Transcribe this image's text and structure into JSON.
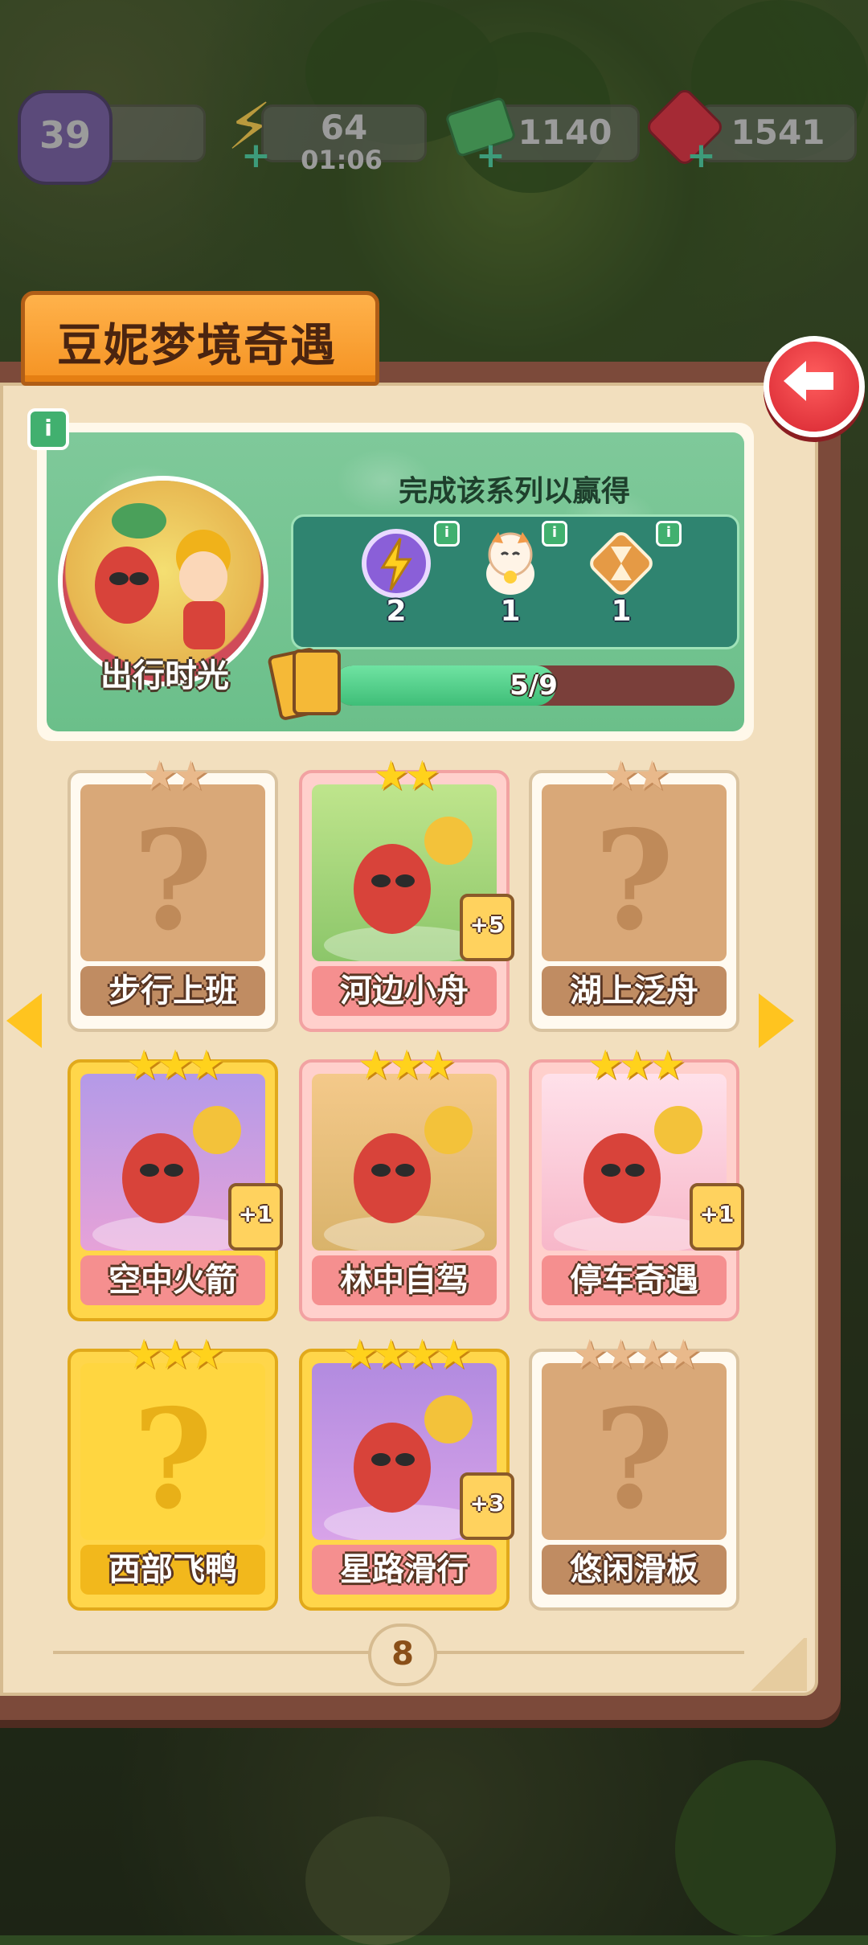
{
  "hud": {
    "level": "39",
    "energy": "64",
    "energy_timer": "01:06",
    "cash": "1140",
    "gems": "1541"
  },
  "title": "豆妮梦境奇遇",
  "series": {
    "name": "出行时光",
    "reward_title": "完成该系列以赢得",
    "rewards": [
      {
        "icon": "lightning-orb-icon",
        "count": "2"
      },
      {
        "icon": "lucky-cat-icon",
        "count": "1"
      },
      {
        "icon": "hourglass-icon",
        "count": "1"
      }
    ],
    "progress_text": "5/9",
    "progress_fraction": 0.556
  },
  "cards": [
    {
      "name": "步行上班",
      "stars": 2,
      "max_stars": 2,
      "state": "locked",
      "frame": "white",
      "dup": ""
    },
    {
      "name": "河边小舟",
      "stars": 2,
      "max_stars": 2,
      "state": "owned",
      "frame": "pink",
      "dup": "+5"
    },
    {
      "name": "湖上泛舟",
      "stars": 2,
      "max_stars": 2,
      "state": "locked",
      "frame": "white",
      "dup": ""
    },
    {
      "name": "空中火箭",
      "stars": 3,
      "max_stars": 3,
      "state": "owned",
      "frame": "gold",
      "dup": "+1"
    },
    {
      "name": "林中自驾",
      "stars": 3,
      "max_stars": 3,
      "state": "owned",
      "frame": "pink",
      "dup": ""
    },
    {
      "name": "停车奇遇",
      "stars": 3,
      "max_stars": 3,
      "state": "owned",
      "frame": "pink",
      "dup": "+1"
    },
    {
      "name": "西部飞鸭",
      "stars": 3,
      "max_stars": 3,
      "state": "locked",
      "frame": "gold",
      "dup": ""
    },
    {
      "name": "星路滑行",
      "stars": 4,
      "max_stars": 4,
      "state": "owned",
      "frame": "gold",
      "dup": "+3"
    },
    {
      "name": "悠闲滑板",
      "stars": 4,
      "max_stars": 4,
      "state": "locked",
      "frame": "white",
      "dup": ""
    }
  ],
  "page_number": "8",
  "colors": {
    "accent_orange": "#f59323",
    "panel_green": "#6bbf8a",
    "back_red": "#d62530",
    "star_gold": "#ffd21c"
  }
}
